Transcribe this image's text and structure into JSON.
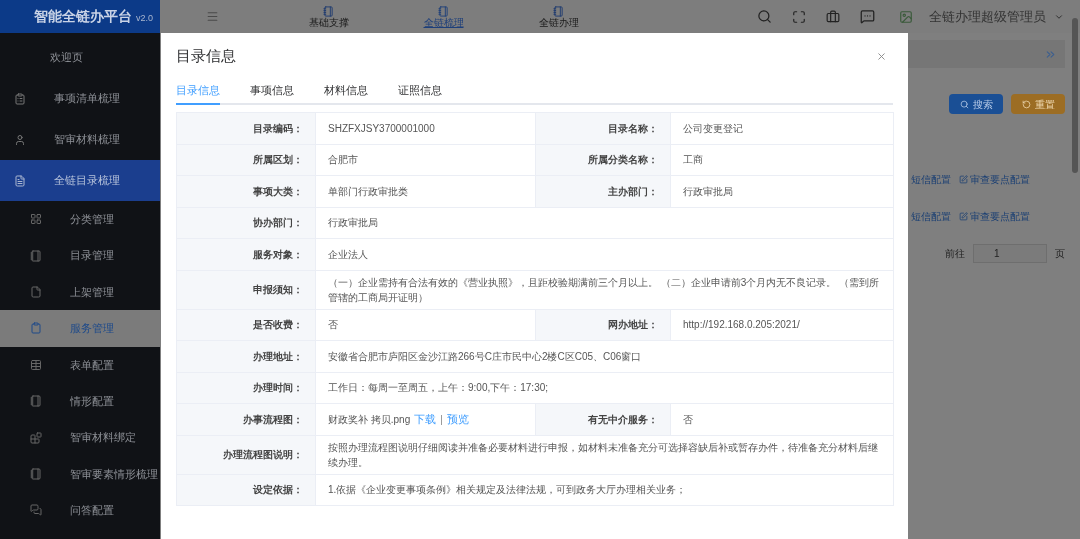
{
  "brand": {
    "title": "智能全链办平台",
    "version": "v2.0"
  },
  "top_nav": [
    {
      "label": "基础支撑",
      "selected": false
    },
    {
      "label": "全链梳理",
      "selected": true
    },
    {
      "label": "全链办理",
      "selected": false
    }
  ],
  "user": {
    "name": "全链办理超级管理员"
  },
  "sidebar": {
    "items": [
      {
        "label": "欢迎页",
        "selected": false
      },
      {
        "label": "事项清单梳理",
        "selected": false
      },
      {
        "label": "智审材料梳理",
        "selected": false
      },
      {
        "label": "全链目录梳理",
        "selected": true,
        "children": [
          {
            "label": "分类管理",
            "selected": false
          },
          {
            "label": "目录管理",
            "selected": false
          },
          {
            "label": "上架管理",
            "selected": false
          },
          {
            "label": "服务管理",
            "selected": true
          },
          {
            "label": "表单配置",
            "selected": false
          },
          {
            "label": "情形配置",
            "selected": false
          },
          {
            "label": "智审材料绑定",
            "selected": false
          },
          {
            "label": "智审要素情形梳理",
            "selected": false
          },
          {
            "label": "问答配置",
            "selected": false
          }
        ]
      }
    ]
  },
  "background": {
    "buttons": [
      {
        "label": "搜索",
        "kind": "primary"
      },
      {
        "label": "重置",
        "kind": "warning"
      }
    ],
    "row_links": [
      {
        "sms": "短信配置",
        "review": "审查要点配置"
      },
      {
        "sms": "短信配置",
        "review": "审查要点配置"
      }
    ],
    "pager": {
      "goto": "前往",
      "page": "1",
      "unit": "页"
    }
  },
  "dialog": {
    "title": "目录信息",
    "tabs": [
      {
        "label": "目录信息",
        "selected": true
      },
      {
        "label": "事项信息",
        "selected": false
      },
      {
        "label": "材料信息",
        "selected": false
      },
      {
        "label": "证照信息",
        "selected": false
      }
    ],
    "rows": [
      {
        "kind": "pair",
        "label": "目录编码：",
        "value": "SHZFXJSY3700001000",
        "label2": "目录名称：",
        "value2": "公司变更登记"
      },
      {
        "kind": "pair",
        "label": "所属区划：",
        "value": "合肥市",
        "label2": "所属分类名称：",
        "value2": "工商"
      },
      {
        "kind": "pair",
        "label": "事项大类：",
        "value": "单部门行政审批类",
        "label2": "主办部门：",
        "value2": "行政审批局"
      },
      {
        "kind": "single",
        "label": "协办部门：",
        "value": "行政审批局"
      },
      {
        "kind": "single",
        "label": "服务对象：",
        "value": "企业法人"
      },
      {
        "kind": "single",
        "label": "申报须知：",
        "value": "（一）企业需持有合法有效的《营业执照》，且距校验期满前三个月以上。 （二）企业申请前3个月内无不良记录。 （需到所管辖的工商局开证明）"
      },
      {
        "kind": "pair",
        "label": "是否收费：",
        "value": "否",
        "label2": "网办地址：",
        "value2": "http://192.168.0.205:2021/"
      },
      {
        "kind": "single",
        "label": "办理地址：",
        "value": "安徽省合肥市庐阳区金沙江路266号C庄市民中心2楼C区C05、C06窗口"
      },
      {
        "kind": "single",
        "label": "办理时间：",
        "value": "工作日：每周一至周五，上午：9:00,下午：17:30;"
      },
      {
        "kind": "file",
        "label": "办事流程图：",
        "value": "财政奖补 拷贝.png",
        "links": [
          "下载",
          "预览"
        ],
        "separator": "|",
        "label2": "有无中介服务：",
        "value2": "否"
      },
      {
        "kind": "single",
        "label": "办理流程图说明：",
        "value": "按照办理流程图说明仔细阅读并准备必要材料进行申报，如材料未准备充分可选择容缺后补或暂存办件，待准备充分材料后继续办理。"
      },
      {
        "kind": "single",
        "label": "设定依据：",
        "value": "1.依据《企业变更事项条例》相关规定及法律法规，可到政务大厅办理相关业务；"
      }
    ]
  }
}
